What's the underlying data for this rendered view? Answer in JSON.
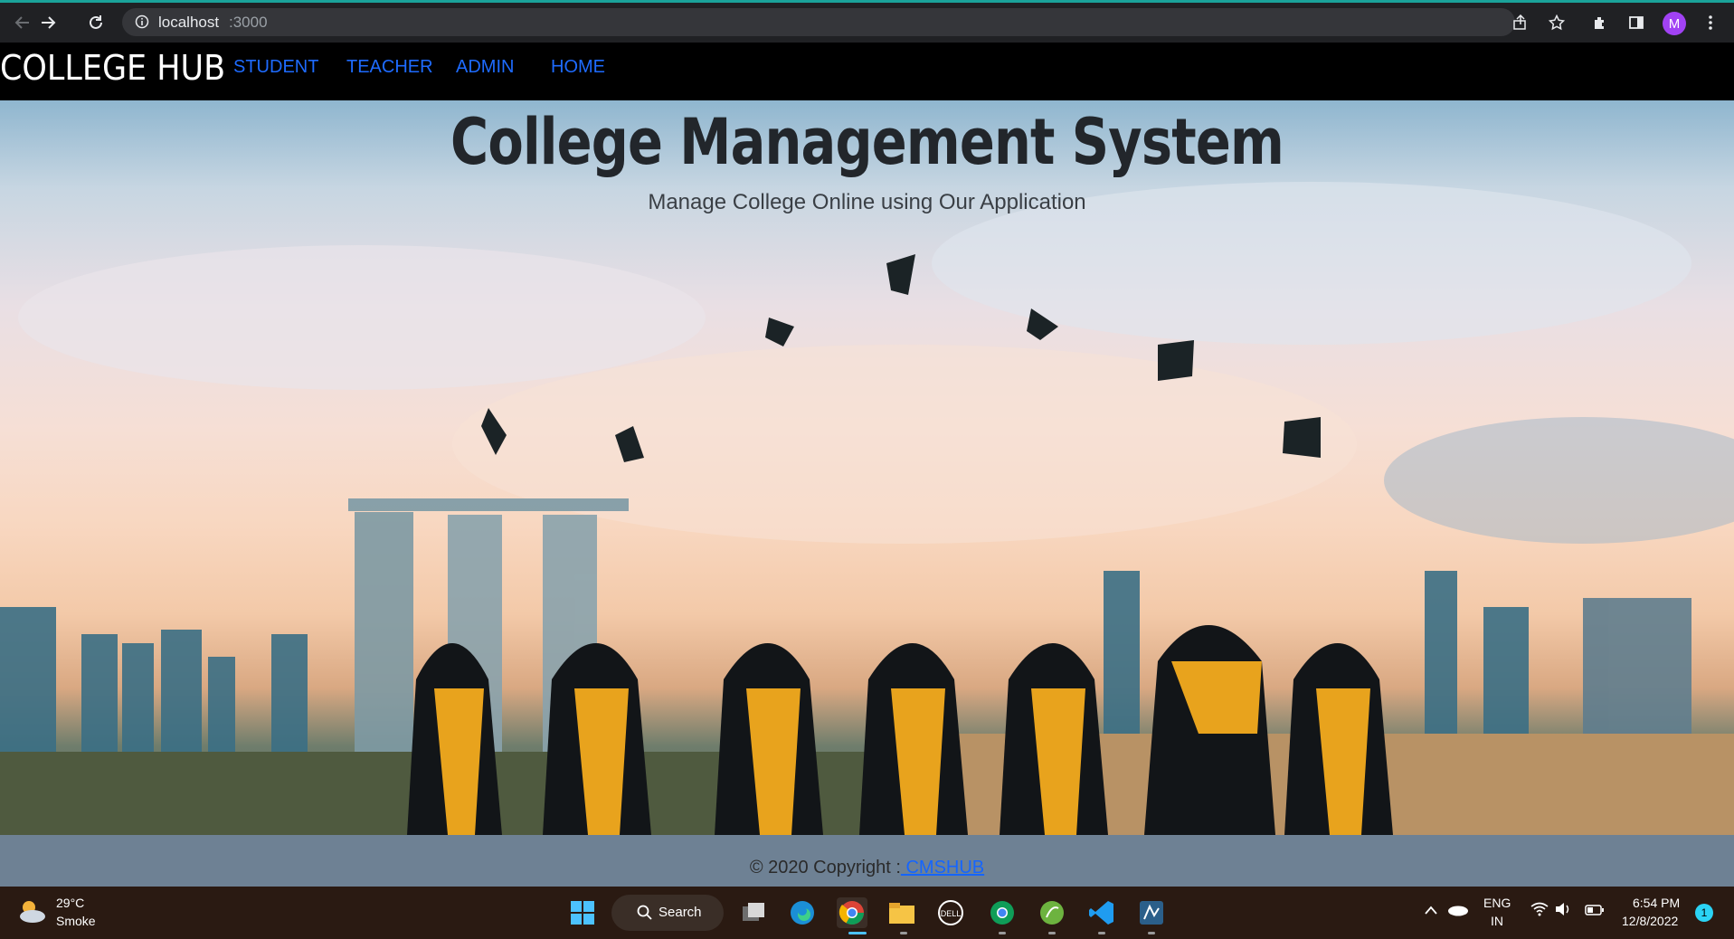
{
  "browser": {
    "url_host": "localhost",
    "url_port": ":3000",
    "profile_initial": "M",
    "icons": [
      "back-icon",
      "forward-icon",
      "reload-icon",
      "info-icon",
      "share-icon",
      "star-icon",
      "extensions-icon",
      "sidepanel-icon",
      "menu-icon"
    ]
  },
  "navbar": {
    "brand": "COLLEGE HUB",
    "links": [
      {
        "label": "STUDENT"
      },
      {
        "label": "TEACHER"
      },
      {
        "label": "ADMIN"
      },
      {
        "label": "HOME"
      }
    ]
  },
  "hero": {
    "title": "College Management System",
    "subtitle": "Manage College Online using Our Application"
  },
  "footer": {
    "copyright": "© 2020 Copyright :",
    "link": " CMSHUB"
  },
  "taskbar": {
    "weather_temp": "29°C",
    "weather_desc": "Smoke",
    "search_label": "Search",
    "language": "ENG",
    "region": "IN",
    "time": "6:54 PM",
    "date": "12/8/2022",
    "notification_count": "1"
  },
  "colors": {
    "nav_link": "#1e6bff",
    "footer_bg": "#6e8194",
    "footer_link": "#1565ff"
  }
}
